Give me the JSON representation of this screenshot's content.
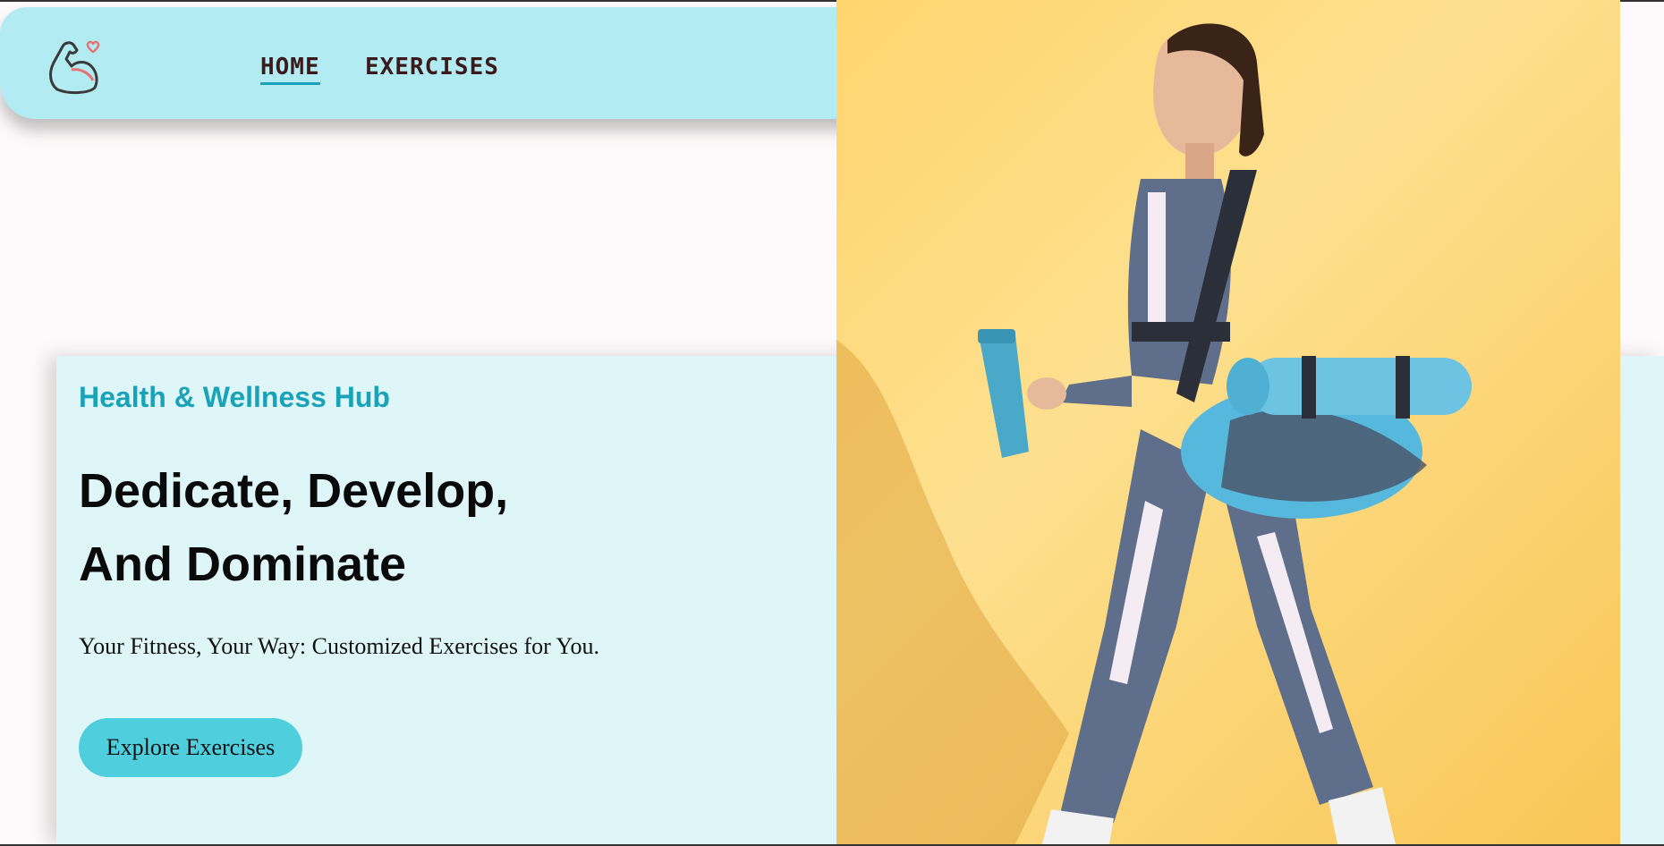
{
  "nav": {
    "logo": "flexed-arm-heart-icon",
    "home_label": "HOME",
    "exercises_label": "EXERCISES"
  },
  "hero": {
    "eyebrow": "Health & Wellness Hub",
    "headline_line1": "Dedicate, Develop,",
    "headline_line2": "And Dominate",
    "subtitle": "Your Fitness, Your Way: Customized Exercises for You.",
    "cta_label": "Explore Exercises",
    "image": "woman-walking-with-yoga-mat-and-water-bottle-photo"
  },
  "colors": {
    "accent": "#1aa3b8",
    "nav_bg": "#b2ebf2",
    "hero_bg": "#dff6f8",
    "button_bg": "#4fcfdd",
    "image_bg": "#fde08f"
  }
}
